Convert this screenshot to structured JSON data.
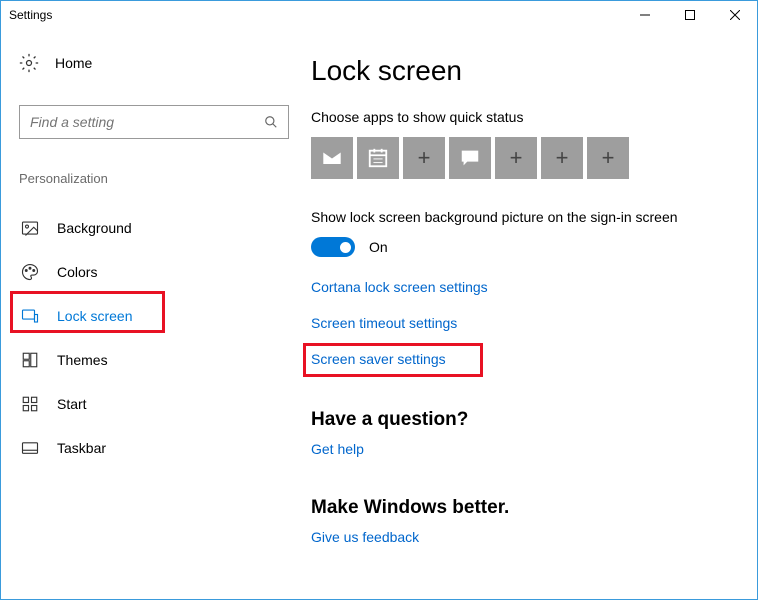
{
  "window": {
    "title": "Settings"
  },
  "sidebar": {
    "home": "Home",
    "search_placeholder": "Find a setting",
    "section": "Personalization",
    "items": [
      {
        "label": "Background"
      },
      {
        "label": "Colors"
      },
      {
        "label": "Lock screen"
      },
      {
        "label": "Themes"
      },
      {
        "label": "Start"
      },
      {
        "label": "Taskbar"
      }
    ]
  },
  "main": {
    "title": "Lock screen",
    "choose_apps": "Choose apps to show quick status",
    "show_bg_label": "Show lock screen background picture on the sign-in screen",
    "toggle_state": "On",
    "links": {
      "cortana": "Cortana lock screen settings",
      "timeout": "Screen timeout settings",
      "saver": "Screen saver settings"
    },
    "question_heading": "Have a question?",
    "help_link": "Get help",
    "better_heading": "Make Windows better.",
    "feedback_link": "Give us feedback"
  }
}
